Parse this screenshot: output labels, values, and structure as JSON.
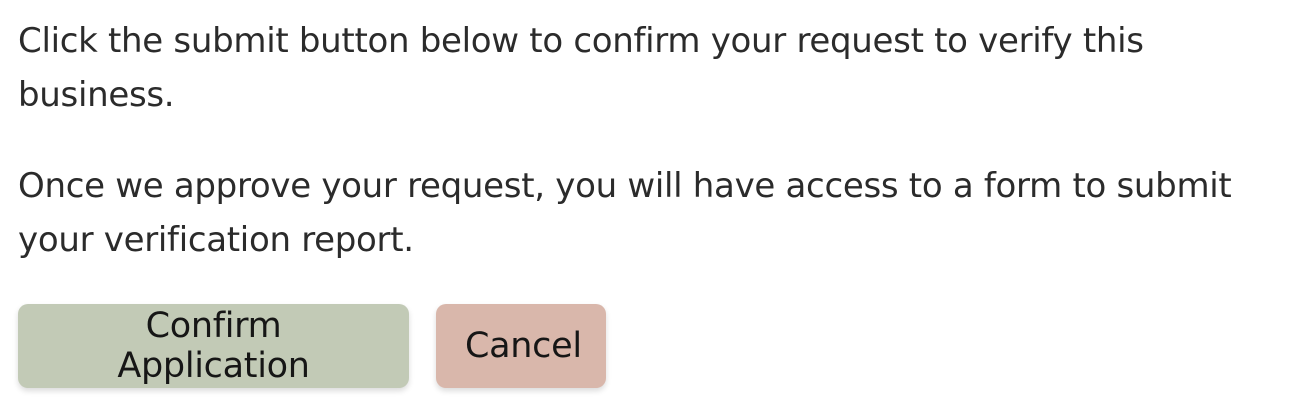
{
  "message": {
    "line1": "Click the submit button below to confirm your request to verify this business.",
    "line2": "Once we approve your request, you will have access to a form to submit your verification report."
  },
  "actions": {
    "confirm_label": "Confirm Application",
    "cancel_label": "Cancel"
  },
  "colors": {
    "confirm_bg": "#c2cab6",
    "cancel_bg": "#d9b7ab",
    "text": "#2b2b2b"
  }
}
